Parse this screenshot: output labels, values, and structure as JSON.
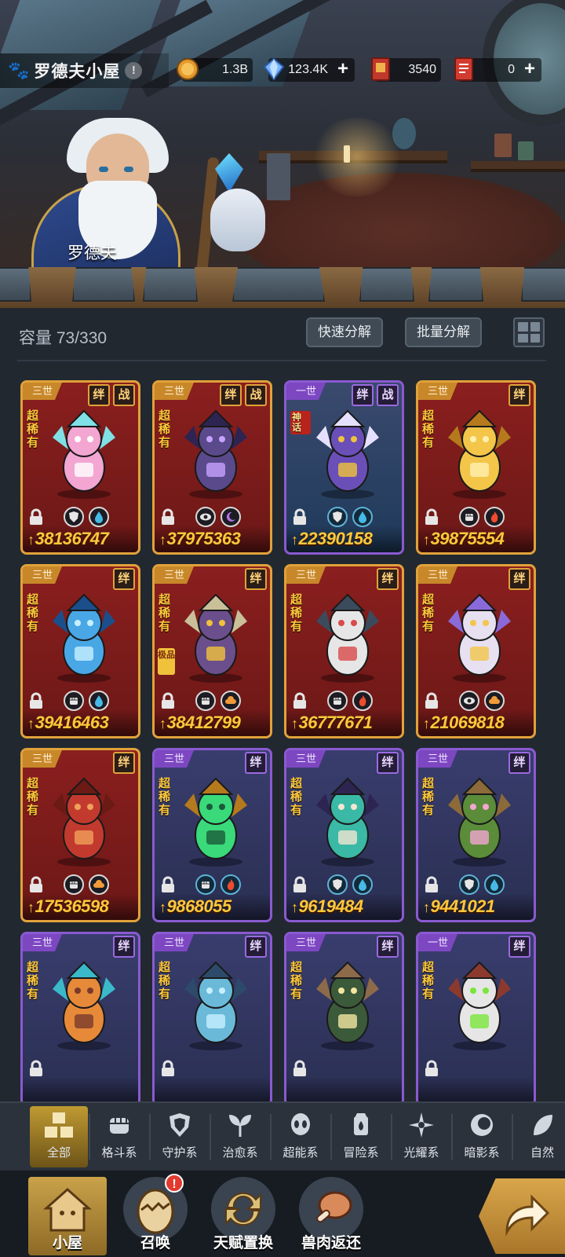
{
  "header": {
    "location_title": "罗德夫小屋",
    "info_icon": "exclamation-icon",
    "npc_name": "罗德夫",
    "resources": [
      {
        "icon": "gold-coin-icon",
        "value": "1.3B",
        "has_plus": false
      },
      {
        "icon": "crystal-icon",
        "value": "123.4K",
        "has_plus": true
      },
      {
        "icon": "ticket-card-icon",
        "value": "3540",
        "has_plus": false
      },
      {
        "icon": "red-ticket-icon",
        "value": "0",
        "has_plus": true
      }
    ]
  },
  "panel": {
    "capacity": "容量 73/330",
    "quick_decompose": "快速分解",
    "batch_decompose": "批量分解"
  },
  "cards": [
    {
      "gen": "三世",
      "tags": [
        "绊",
        "战"
      ],
      "rarity": "超稀有",
      "frame": "gold",
      "elements": [
        "shield-icon",
        "water-drop-icon"
      ],
      "power": "38136747",
      "monster": "pink-winged-fairy"
    },
    {
      "gen": "三世",
      "tags": [
        "绊",
        "战"
      ],
      "rarity": "超稀有",
      "frame": "gold",
      "elements": [
        "eye-icon",
        "moon-icon"
      ],
      "power": "37975363",
      "monster": "purple-nine-tail-fox"
    },
    {
      "gen": "一世",
      "tags": [
        "绊",
        "战"
      ],
      "rarity": "神话",
      "frame": "purple-blue",
      "elements": [
        "shield-icon",
        "water-drop-icon"
      ],
      "power": "22390158",
      "monster": "violet-armored-mage"
    },
    {
      "gen": "三世",
      "tags": [
        "绊"
      ],
      "rarity": "超稀有",
      "frame": "gold",
      "elements": [
        "fist-icon",
        "fire-icon"
      ],
      "power": "39875554",
      "monster": "golden-sun-warrior"
    },
    {
      "gen": "三世",
      "tags": [
        "绊"
      ],
      "rarity": "超稀有",
      "frame": "gold",
      "elements": [
        "fist-icon",
        "water-drop-icon"
      ],
      "power": "39416463",
      "monster": "blue-ice-spirit"
    },
    {
      "gen": "三世",
      "tags": [
        "绊"
      ],
      "rarity": "超稀有",
      "badge": "极品",
      "frame": "gold",
      "elements": [
        "fist-icon",
        "cloud-icon"
      ],
      "power": "38412799",
      "monster": "hooded-rock-golem"
    },
    {
      "gen": "三世",
      "tags": [
        "绊"
      ],
      "rarity": "超稀有",
      "frame": "gold",
      "elements": [
        "fist-icon",
        "fire-icon"
      ],
      "power": "36777671",
      "monster": "sheep-mech-gunner"
    },
    {
      "gen": "三世",
      "tags": [
        "绊"
      ],
      "rarity": "超稀有",
      "frame": "gold",
      "elements": [
        "eye-icon",
        "cloud-icon"
      ],
      "power": "21069818",
      "monster": "white-bone-dragon"
    },
    {
      "gen": "三世",
      "tags": [
        "绊"
      ],
      "rarity": "超稀有",
      "frame": "gold",
      "elements": [
        "fist-icon",
        "cloud-icon"
      ],
      "power": "17536598",
      "monster": "crimson-lion-beast"
    },
    {
      "gen": "三世",
      "tags": [
        "绊"
      ],
      "rarity": "超稀有",
      "frame": "purple",
      "elements": [
        "fist-icon",
        "fire-icon"
      ],
      "power": "9868055",
      "monster": "green-flame-beetle"
    },
    {
      "gen": "三世",
      "tags": [
        "绊"
      ],
      "rarity": "超稀有",
      "frame": "purple",
      "elements": [
        "shield-icon",
        "water-drop-icon"
      ],
      "power": "9619484",
      "monster": "teal-haired-fox-girl"
    },
    {
      "gen": "三世",
      "tags": [
        "绊"
      ],
      "rarity": "超稀有",
      "frame": "purple",
      "elements": [
        "shield-icon",
        "water-drop-icon"
      ],
      "power": "9441021",
      "monster": "tree-spirit-golem"
    },
    {
      "gen": "三世",
      "tags": [
        "绊"
      ],
      "rarity": "超稀有",
      "frame": "purple",
      "elements": [],
      "power": "",
      "monster": "orange-crest-dragon"
    },
    {
      "gen": "三世",
      "tags": [
        "绊"
      ],
      "rarity": "超稀有",
      "frame": "purple",
      "elements": [],
      "power": "",
      "monster": "crystal-wolf"
    },
    {
      "gen": "三世",
      "tags": [
        "绊"
      ],
      "rarity": "超稀有",
      "frame": "purple",
      "elements": [],
      "power": "",
      "monster": "mossy-treant"
    },
    {
      "gen": "一世",
      "tags": [
        "绊"
      ],
      "rarity": "超稀有",
      "frame": "purple",
      "elements": [],
      "power": "",
      "monster": "goggle-sheep-engineer"
    }
  ],
  "categories": [
    {
      "label": "全部",
      "icon": "stack-boxes-icon",
      "active": true
    },
    {
      "label": "格斗系",
      "icon": "fist-icon"
    },
    {
      "label": "守护系",
      "icon": "shield-icon"
    },
    {
      "label": "治愈系",
      "icon": "sprout-icon"
    },
    {
      "label": "超能系",
      "icon": "alien-head-icon"
    },
    {
      "label": "冒险系",
      "icon": "lantern-icon"
    },
    {
      "label": "光耀系",
      "icon": "star-compass-icon"
    },
    {
      "label": "暗影系",
      "icon": "eclipse-icon"
    },
    {
      "label": "自然",
      "icon": "leaf-icon"
    }
  ],
  "bottom_nav": [
    {
      "label": "小屋",
      "icon": "house-icon",
      "active": true
    },
    {
      "label": "召唤",
      "icon": "egg-icon",
      "alert": "!"
    },
    {
      "label": "天赋置换",
      "icon": "swap-arrows-icon"
    },
    {
      "label": "兽肉返还",
      "icon": "meat-leg-icon"
    }
  ],
  "go_icon": "curved-arrow-icon",
  "colors": {
    "gold_frame": "#e0a23a",
    "purple_frame": "#8a5ad1",
    "power_text": "#ffc83a",
    "rarity_text": "#ffc83a",
    "alert_red": "#e23a2e"
  }
}
